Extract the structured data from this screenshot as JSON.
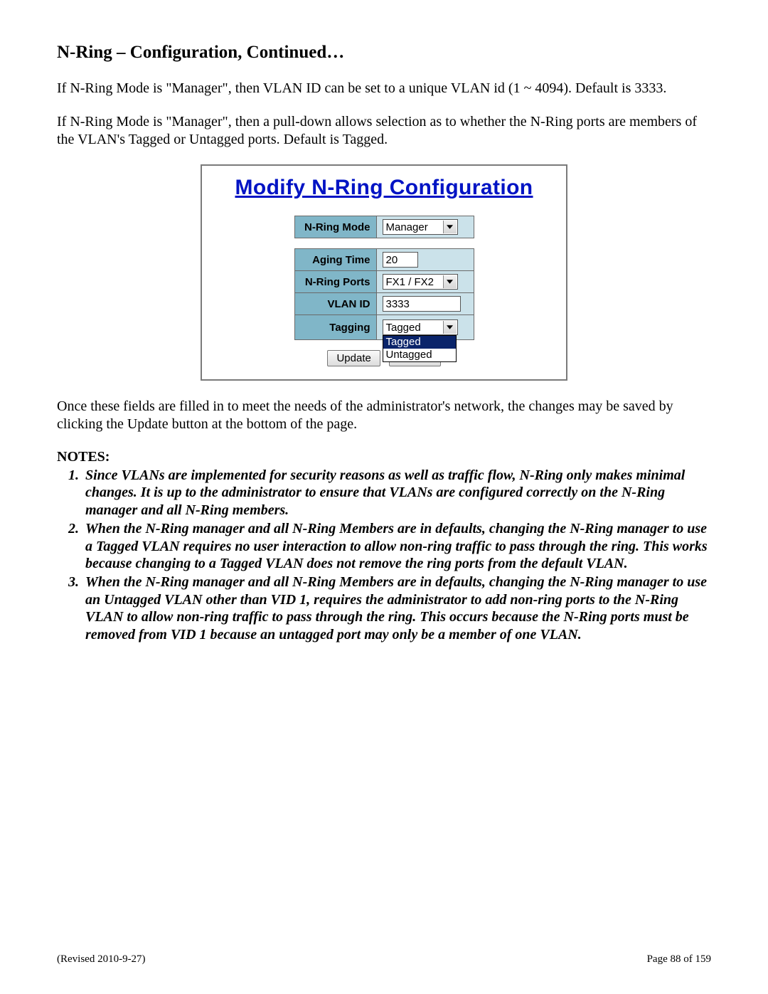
{
  "section_title": "N-Ring – Configuration, Continued…",
  "para1": "If N-Ring Mode is \"Manager\", then VLAN ID can be set to a unique VLAN id (1 ~ 4094). Default is 3333.",
  "para2": "If N-Ring Mode is \"Manager\", then a pull-down allows selection as to whether the N-Ring ports are members of the VLAN's Tagged or Untagged ports.  Default is Tagged.",
  "panel": {
    "title": "Modify N-Ring Configuration",
    "mode_label": "N-Ring Mode",
    "mode_value": "Manager",
    "aging_label": "Aging Time",
    "aging_value": "20",
    "ports_label": "N-Ring Ports",
    "ports_value": "FX1 / FX2",
    "vlan_label": "VLAN ID",
    "vlan_value": "3333",
    "tagging_label": "Tagging",
    "tagging_value": "Tagged",
    "tagging_options": {
      "opt1": "Tagged",
      "opt2": "Untagged"
    },
    "update_btn": "Update",
    "cancel_btn": "Cancel"
  },
  "para3": "Once these fields are filled in to meet the needs of the administrator's network, the changes may be saved by clicking the Update button at the bottom of the page.",
  "notes_heading": "NOTES:",
  "notes": {
    "n1": "Since VLANs are implemented for security reasons as well as traffic flow, N-Ring only makes minimal changes.  It is up to the administrator to ensure that VLANs are configured correctly on the N-Ring manager and all N-Ring members.",
    "n2": "When the N-Ring manager and all N-Ring Members are in defaults, changing the N-Ring manager to use a Tagged VLAN requires no user interaction to allow non-ring traffic to pass through the ring.  This works because changing to a Tagged VLAN does not remove the ring ports from the default VLAN.",
    "n3": "When the N-Ring manager and all N-Ring Members are in defaults, changing the N-Ring manager to use an Untagged VLAN other than VID 1, requires the administrator to add non-ring ports to the N-Ring VLAN to allow non-ring traffic to pass through the ring.  This occurs because the N-Ring ports must be removed from VID 1 because an untagged port may only be a member of one VLAN."
  },
  "footer": {
    "revised": "(Revised 2010-9-27)",
    "page": "Page 88 of 159"
  }
}
